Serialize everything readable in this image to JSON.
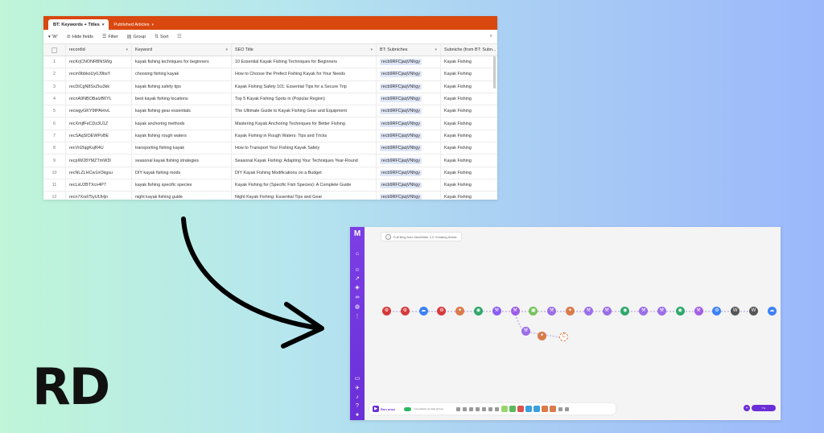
{
  "airtable": {
    "tabs": [
      {
        "label": "BT: Keywords + Titles"
      },
      {
        "label": "Published Articles"
      }
    ],
    "toolbar": {
      "view_label": "▾ 'W'",
      "hide_fields": "Hide fields",
      "filter": "Filter",
      "group": "Group",
      "sort": "Sort"
    },
    "columns": [
      "recordId",
      "Keyword",
      "SEO Title",
      "BT: Subniches",
      "Subniche (from BT: Subn..."
    ],
    "rows": [
      {
        "n": "1",
        "id": "recKrjCNONRBNSWg",
        "kw": "kayak fishing techniques for beginners",
        "title": "10 Essential Kayak Fishing Techniques for Beginners",
        "sub": "recb9RFCjaqVNhgy",
        "niche": "Kayak Fishing"
      },
      {
        "n": "2",
        "id": "recm9bbkoUy0J9bsY",
        "kw": "choosing fishing kayak",
        "title": "How to Choose the Prefect Fishing Kayak for Your Needs",
        "sub": "recb9RFCjaqVNhgy",
        "niche": "Kayak Fishing"
      },
      {
        "n": "3",
        "id": "recDiCgN8SxZku3kk",
        "kw": "kayak fishing safety tips",
        "title": "Kayak Fishing Safety 101: Essential Tips for a Secure Trip",
        "sub": "recb9RFCjaqVNhgy",
        "niche": "Kayak Fishing"
      },
      {
        "n": "4",
        "id": "recnA9NBOBaIzB6YL",
        "kw": "best kayak fishing locations",
        "title": "Top 5 Kayak Fishing Spots in (Popular Region)",
        "sub": "recb9RFCjaqVNhgy",
        "niche": "Kayak Fishing"
      },
      {
        "n": "5",
        "id": "recwgyGKY9tPAHrvL",
        "kw": "kayak fishing gear essentials",
        "title": "The Ultimate Guide to Kayak Fishing Gear and Equipment",
        "sub": "recb9RFCjaqVNhgy",
        "niche": "Kayak Fishing"
      },
      {
        "n": "6",
        "id": "recXmjfFeCDz3U1Z",
        "kw": "kayak anchoring methods",
        "title": "Mastering Kayak Anchoring Techniques for Better Fishing",
        "sub": "recb9RFCjaqVNhgy",
        "niche": "Kayak Fishing"
      },
      {
        "n": "7",
        "id": "recSAqSlOEWPoBE",
        "kw": "kayak fishing rough waters",
        "title": "Kayak Fishing in Rough Waters: Tips and Tricks",
        "sub": "recb9RFCjaqVNhgy",
        "niche": "Kayak Fishing"
      },
      {
        "n": "8",
        "id": "recVri2IqgKsjR4U",
        "kw": "transporting fishing kayak",
        "title": "How to Transport Your Fishing Kayak Safely",
        "sub": "recb9RFCjaqVNhgy",
        "niche": "Kayak Fishing"
      },
      {
        "n": "9",
        "id": "recpIW28YMZTmW3I",
        "kw": "seasonal kayak fishing strategies",
        "title": "Seasonal Kayak Fishing: Adapting Your Techniques Year-Round",
        "sub": "recb9RFCjaqVNhgy",
        "niche": "Kayak Fishing"
      },
      {
        "n": "10",
        "id": "recNLZLHCw1nOkgsu",
        "kw": "DIY kayak fishing mods",
        "title": "DIY Kayak Fishing Modifications on a Budget",
        "sub": "recb9RFCjaqVNhgy",
        "niche": "Kayak Fishing"
      },
      {
        "n": "11",
        "id": "recLsU2BTXcn4P7",
        "kw": "kayak fishing specific species",
        "title": "Kayak Fishing for (Specific Fish Species): A Complete Guide",
        "sub": "recb9RFCjaqVNhgy",
        "niche": "Kayak Fishing"
      },
      {
        "n": "12",
        "id": "recn7Xod75yUfJHjn",
        "kw": "night kayak fishing guide",
        "title": "Night Kayak Fishing: Essential Tips and Gear",
        "sub": "recb9RFCjaqVNhgy",
        "niche": "Kayak Fishing"
      }
    ]
  },
  "logo_text": "RD",
  "make": {
    "scenario_title": "Full Blog from NeoWriter 1.0 Creating Article",
    "run_once": "Run once",
    "schedule_label": "Immediately as data arrives",
    "right_pill": "≡ ▸ ",
    "nodes_row": [
      {
        "color": "#d63a3a",
        "icon": "⚙"
      },
      {
        "color": "#d63a3a",
        "icon": "⚙"
      },
      {
        "color": "#3b82f6",
        "icon": "☁"
      },
      {
        "color": "#d63a3a",
        "icon": "⚙"
      },
      {
        "color": "#d97b4a",
        "icon": "✦"
      },
      {
        "color": "#2fa86a",
        "icon": "◉"
      },
      {
        "color": "#8b5cf6",
        "icon": "⚒"
      },
      {
        "color": "#9d5ce8",
        "icon": "⚒"
      },
      {
        "color": "#74c25a",
        "icon": "▣"
      },
      {
        "color": "#9b6ee8",
        "icon": "⚒"
      },
      {
        "color": "#d97b4a",
        "icon": "✦"
      },
      {
        "color": "#9b6ee8",
        "icon": "⚒"
      },
      {
        "color": "#9b6ee8",
        "icon": "⚒"
      },
      {
        "color": "#2fa86a",
        "icon": "◉"
      },
      {
        "color": "#9b6ee8",
        "icon": "⚒"
      },
      {
        "color": "#9b6ee8",
        "icon": "⚒"
      },
      {
        "color": "#2fa86a",
        "icon": "◉"
      },
      {
        "color": "#a35ee6",
        "icon": "⚒"
      },
      {
        "color": "#3b82f6",
        "icon": "⚙"
      },
      {
        "color": "#555555",
        "icon": "W"
      },
      {
        "color": "#555555",
        "icon": "W"
      },
      {
        "color": "#3b82f6",
        "icon": "☁"
      }
    ],
    "nodes_branch": [
      {
        "color": "#9b6ee8",
        "icon": "⚒"
      },
      {
        "color": "#d97b4a",
        "icon": "✦"
      },
      {
        "color": "#d97b4a",
        "icon": "C"
      }
    ],
    "bottom_squares": [
      "#9ad46b",
      "#5cb85c",
      "#d9534f",
      "#3aa0e0",
      "#3aa0e0",
      "#d97b4a",
      "#d97b4a"
    ]
  },
  "colors": {
    "airtable_header": "#d9480f",
    "make_sidebar": "#6b2fd8"
  }
}
